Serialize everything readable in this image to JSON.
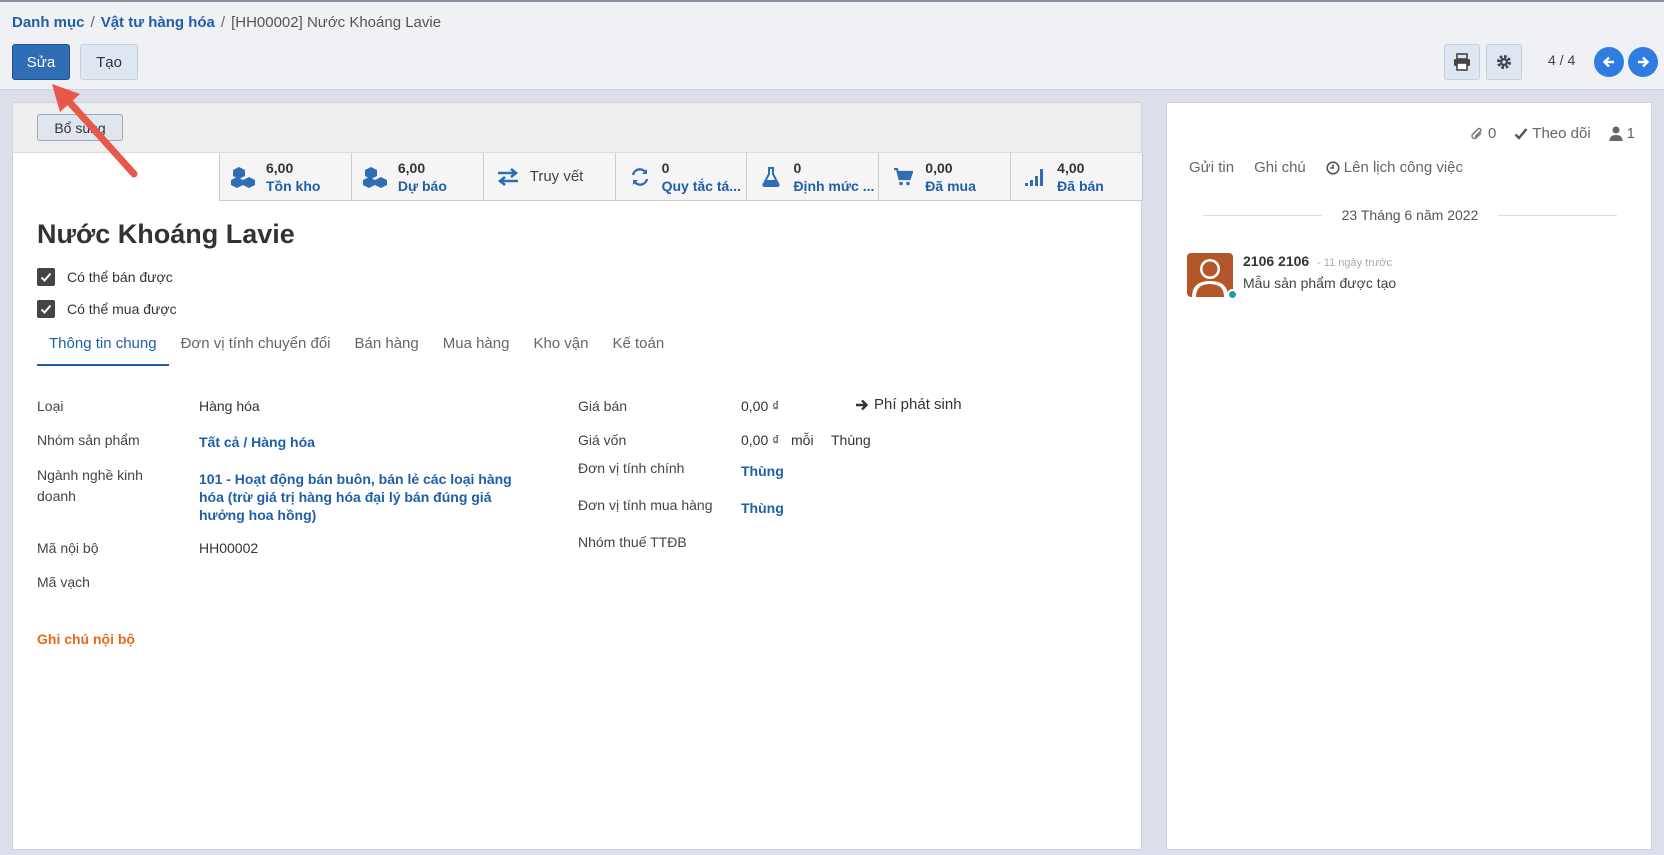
{
  "breadcrumb": {
    "level1": "Danh mục",
    "level2": "Vật tư hàng hóa",
    "current": "[HH00002] Nước Khoáng Lavie"
  },
  "toolbar": {
    "edit": "Sửa",
    "create": "Tạo",
    "pager": "4 / 4"
  },
  "header": {
    "extra_button": "Bổ sung"
  },
  "smart_buttons": [
    {
      "value": "6,00",
      "label": "Tồn kho",
      "icon": "boxes-icon"
    },
    {
      "value": "6,00",
      "label": "Dự báo",
      "icon": "boxes-icon"
    },
    {
      "value": "",
      "label": "Truy vết",
      "icon": "exchange-icon"
    },
    {
      "value": "0",
      "label": "Quy tắc tá...",
      "icon": "refresh-icon"
    },
    {
      "value": "0",
      "label": "Định mức ...",
      "icon": "flask-icon"
    },
    {
      "value": "0,00",
      "label": "Đã mua",
      "icon": "cart-icon"
    },
    {
      "value": "4,00",
      "label": "Đã bán",
      "icon": "signal-icon"
    }
  ],
  "product": {
    "name": "Nước Khoáng Lavie",
    "can_sell": "Có thể bán được",
    "can_buy": "Có thể mua được"
  },
  "tabs": [
    "Thông tin chung",
    "Đơn vị tính chuyển đổi",
    "Bán hàng",
    "Mua hàng",
    "Kho vận",
    "Kế toán"
  ],
  "fields": {
    "type_label": "Loại",
    "type_value": "Hàng hóa",
    "group_label": "Nhóm sản phẩm",
    "group_value": "Tất cả / Hàng hóa",
    "industry_label": "Ngành nghề kinh doanh",
    "industry_value": "101 - Hoạt động bán buôn, bán lẻ các loại hàng hóa (trừ giá trị hàng hóa đại lý bán đúng giá hưởng hoa hồng)",
    "code_label": "Mã nội bộ",
    "code_value": "HH00002",
    "barcode_label": "Mã vạch",
    "note_label": "Ghi chú nội bộ",
    "price_label": "Giá bán",
    "price_value": "0,00 ₫",
    "extra_cost": "Phí phát sinh",
    "cost_label": "Giá vốn",
    "cost_value": "0,00 ₫",
    "cost_per": "mỗi",
    "cost_unit": "Thùng",
    "uom_label": "Đơn vị tính chính",
    "uom_value": "Thùng",
    "uom_po_label": "Đơn vị tính mua hàng",
    "uom_po_value": "Thùng",
    "tax_group_label": "Nhóm thuế TTĐB"
  },
  "chatter": {
    "attachments": "0",
    "follow": "Theo dõi",
    "followers": "1",
    "send_message": "Gửi tin",
    "log_note": "Ghi chú",
    "schedule": "Lên lịch công việc",
    "date": "23 Tháng 6 năm 2022",
    "author": "2106 2106",
    "time": "- 11 ngày trước",
    "body": "Mẫu sản phẩm được tạo"
  },
  "colors": {
    "primary": "#2f6db4",
    "link": "#1f5fa8",
    "accent_orange": "#e8691e",
    "arrow": "#e8584a"
  }
}
